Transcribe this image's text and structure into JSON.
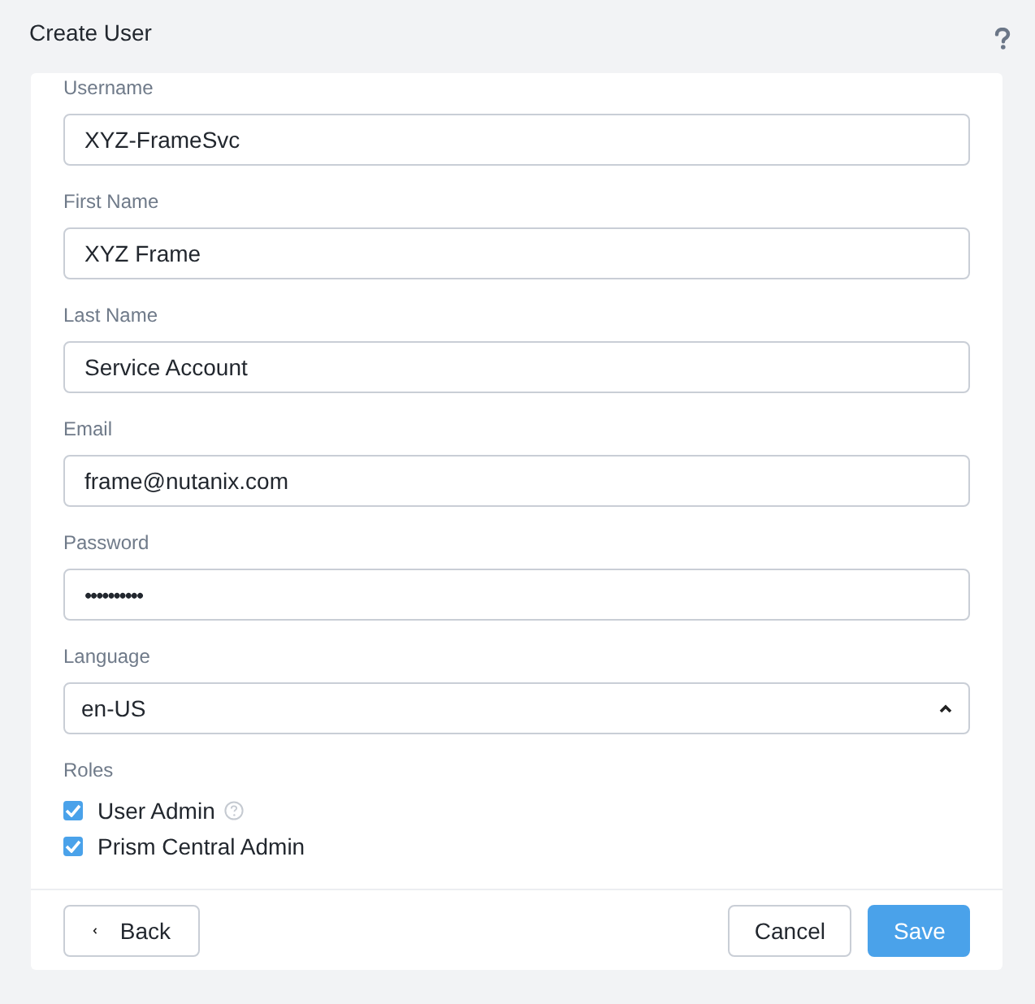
{
  "window": {
    "title": "Create User"
  },
  "fields": [
    {
      "kind": "text",
      "label": "Username",
      "value": "XYZ-FrameSvc"
    },
    {
      "kind": "text",
      "label": "First Name",
      "value": "XYZ Frame"
    },
    {
      "kind": "text",
      "label": "Last Name",
      "value": "Service Account"
    },
    {
      "kind": "text",
      "label": "Email",
      "value": "frame@nutanix.com"
    },
    {
      "kind": "password",
      "label": "Password",
      "value": "••••••••••"
    },
    {
      "kind": "select",
      "label": "Language",
      "value": "en-US",
      "expanded": true
    }
  ],
  "roles": {
    "label": "Roles",
    "items": [
      {
        "label": "User Admin",
        "checked": true,
        "help": true
      },
      {
        "label": "Prism Central Admin",
        "checked": true,
        "help": false
      }
    ]
  },
  "footer": {
    "back": "Back",
    "cancel": "Cancel",
    "save": "Save"
  }
}
